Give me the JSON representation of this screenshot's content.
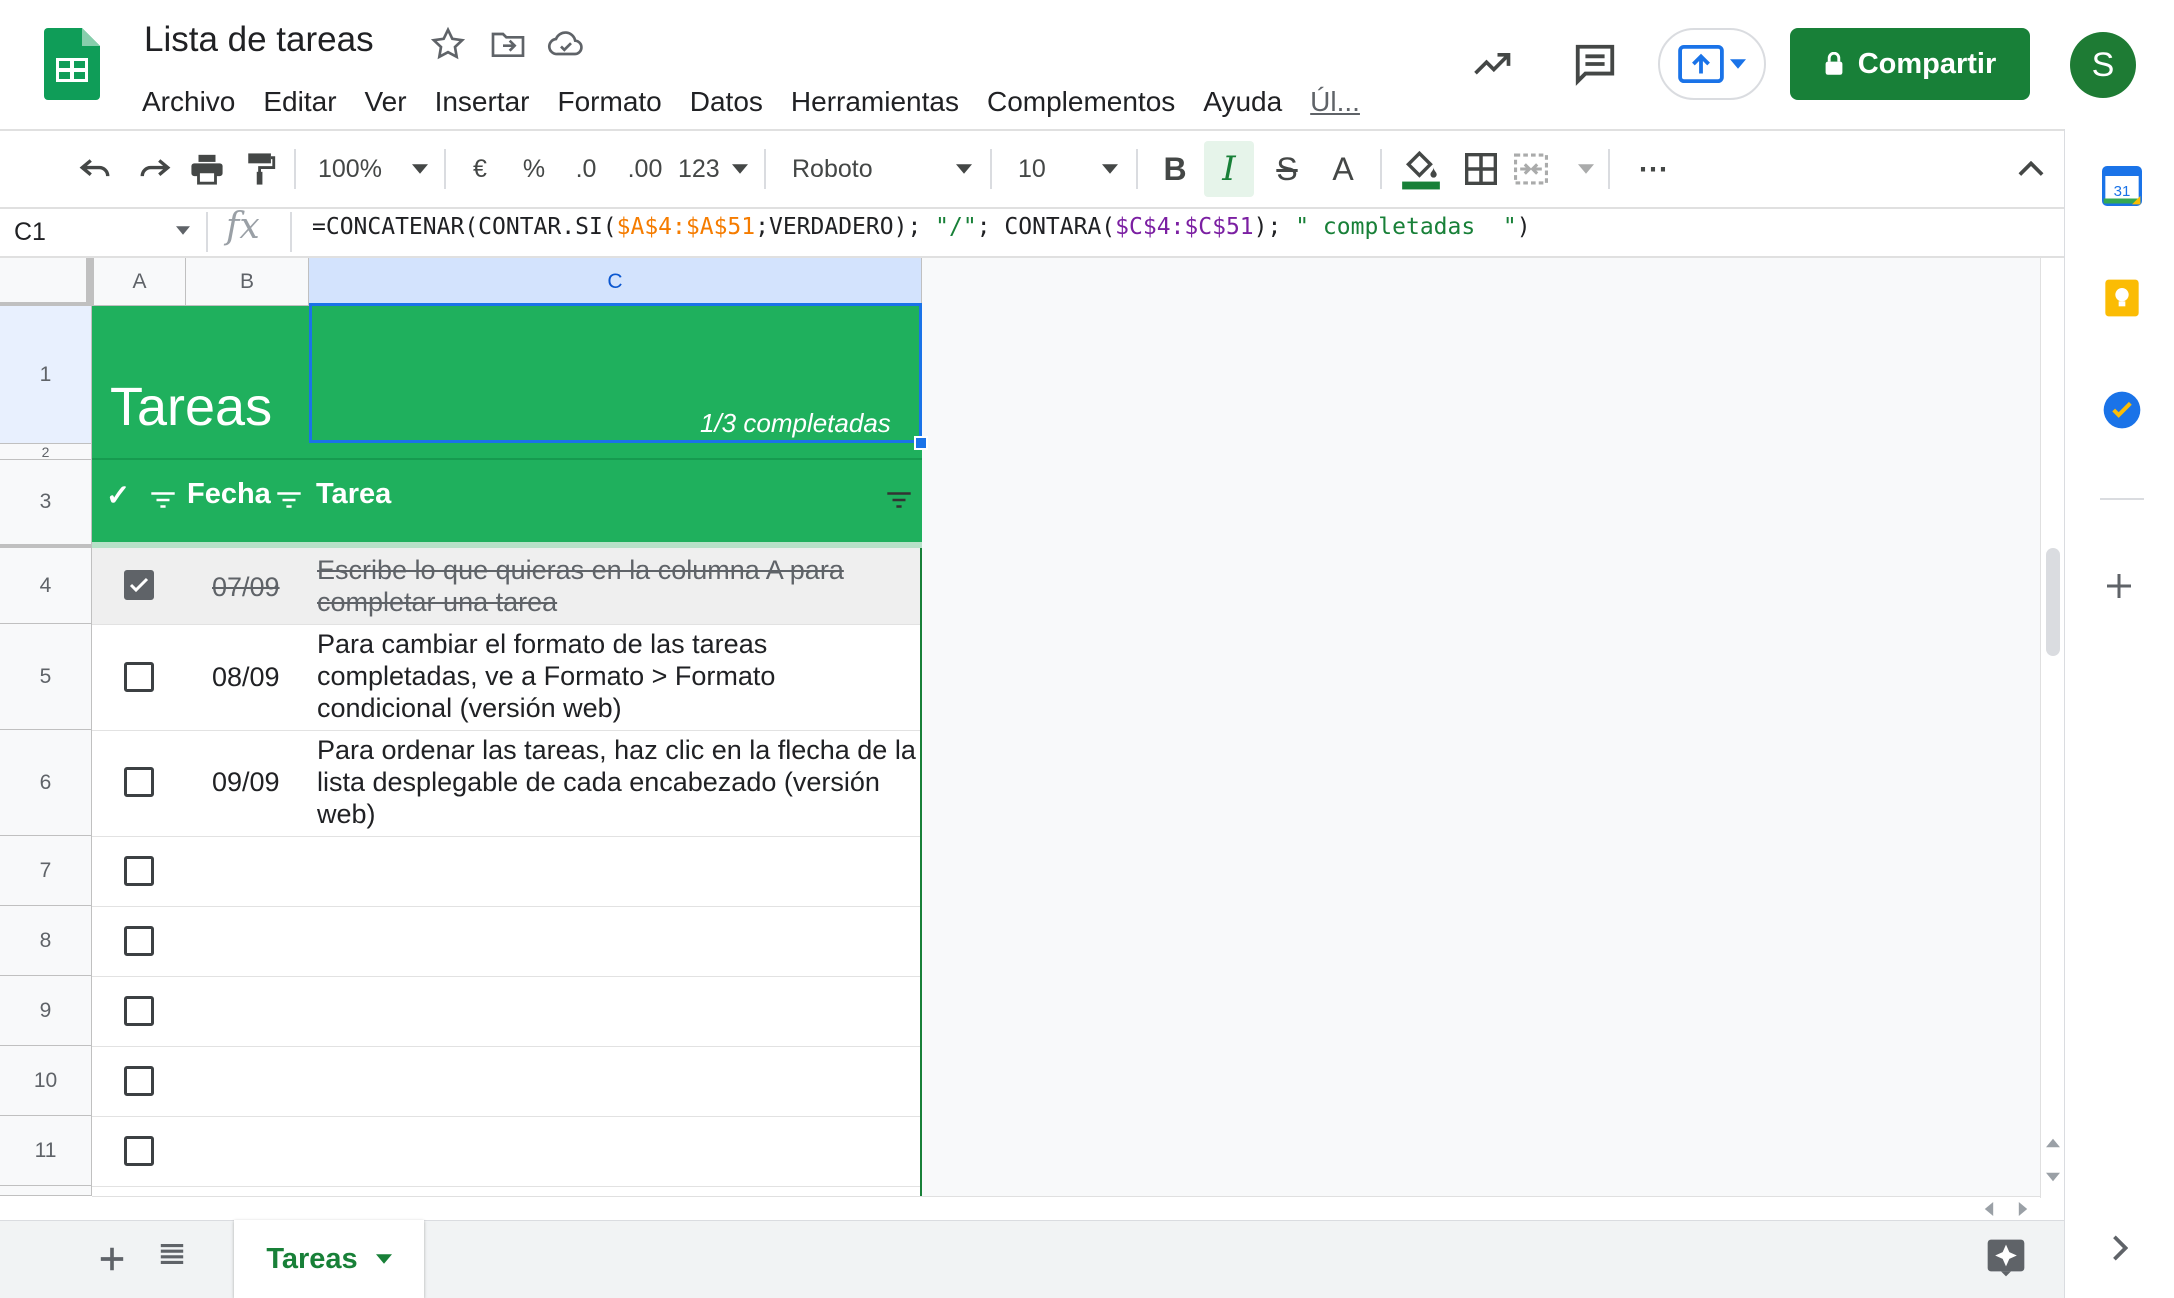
{
  "window": {
    "title": "Lista de tareas",
    "brand_color": "#0f9d58"
  },
  "menu": [
    "Archivo",
    "Editar",
    "Ver",
    "Insertar",
    "Formato",
    "Datos",
    "Herramientas",
    "Complementos",
    "Ayuda"
  ],
  "menu_more": "Úl...",
  "share": {
    "label": "Compartir",
    "color": "#188038"
  },
  "avatar": {
    "initial": "S",
    "color": "#1e7b34"
  },
  "toolbar": {
    "zoom": "100%",
    "currency": "€",
    "percent": "%",
    "decrease_decimals": ".0",
    "increase_decimals": ".00",
    "more_formats": "123",
    "font": "Roboto",
    "font_size": "10",
    "bold": "B",
    "italic": "I",
    "strikethrough": "S",
    "text_color": "A",
    "more": "⋯"
  },
  "formula_bar": {
    "cell_ref": "C1",
    "fx": "fx",
    "parts": [
      "=CONCATENAR(CONTAR.SI(",
      "$A$4:$A$51",
      ";VERDADERO); ",
      "\"/\"",
      "; CONTARA(",
      "$C$4:$C$51",
      "); ",
      "\" completadas  \"",
      ")"
    ]
  },
  "columns": [
    "A",
    "B",
    "C"
  ],
  "rows": [
    "1",
    "2",
    "3",
    "4",
    "5",
    "6",
    "7",
    "8",
    "9",
    "10",
    "11"
  ],
  "sheet": {
    "title": "Tareas",
    "completed_label": "1/3 completadas",
    "header": {
      "check": "✓",
      "date": "Fecha",
      "task": "Tarea"
    },
    "tasks": [
      {
        "checked": true,
        "date": "07/09",
        "text": "Escribe lo que quieras en la columna A para completar una tarea"
      },
      {
        "checked": false,
        "date": "08/09",
        "text": "Para cambiar el formato de las tareas completadas, ve a Formato > Formato condicional (versión web)"
      },
      {
        "checked": false,
        "date": "09/09",
        "text": "Para ordenar las tareas, haz clic en la flecha de la lista desplegable de cada encabezado (versión web)"
      }
    ],
    "header_color": "#1fb05d"
  },
  "tabs": [
    {
      "label": "Tareas",
      "active": true
    }
  ],
  "side_panel": [
    "calendar-icon",
    "keep-icon",
    "tasks-icon"
  ],
  "calendar_day": "31"
}
